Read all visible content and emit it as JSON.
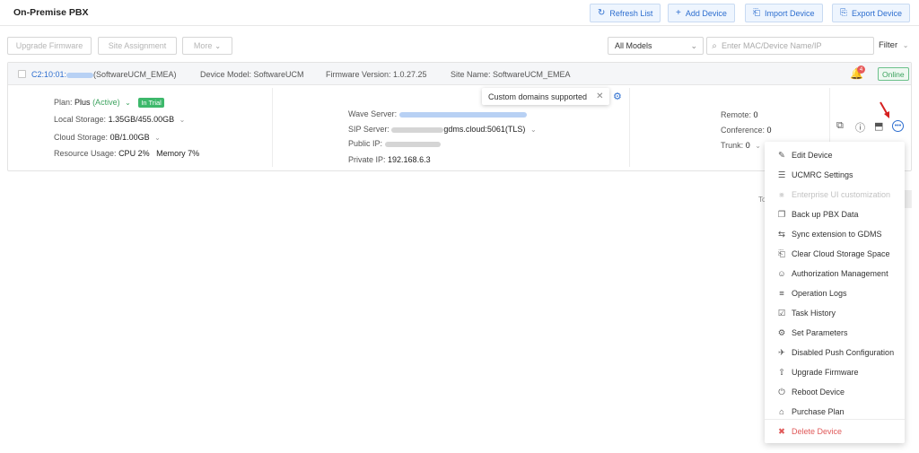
{
  "header": {
    "title": "On-Premise PBX",
    "buttons": {
      "refresh": "Refresh List",
      "add": "Add Device",
      "import": "Import Device",
      "export": "Export Device"
    }
  },
  "toolbar": {
    "upgrade": "Upgrade Firmware",
    "site": "Site Assignment",
    "more": "More",
    "model_select": "All Models",
    "search_placeholder": "Enter MAC/Device Name/IP",
    "filter": "Filter"
  },
  "device": {
    "mac_prefix": "C2:10:01:",
    "name": "(SoftwareUCM_EMEA)",
    "model": "Device Model: SoftwareUCM",
    "firmware": "Firmware Version: 1.0.27.25",
    "site": "Site Name: SoftwareUCM_EMEA",
    "notification_count": "4",
    "status": "Online",
    "plan_label": "Plan:",
    "plan_value": "Plus",
    "plan_state": "(Active)",
    "trial": "In Trial",
    "local_storage_label": "Local Storage:",
    "local_storage_value": "1.35GB/455.00GB",
    "cloud_storage_label": "Cloud Storage:",
    "cloud_storage_value": "0B/1.00GB",
    "resource_label": "Resource Usage:",
    "cpu": "CPU 2%",
    "memory": "Memory 7%",
    "wave_label": "Wave Server:",
    "sip_label": "SIP Server:",
    "sip_value": "gdms.cloud:5061(TLS)",
    "public_ip_label": "Public IP:",
    "private_ip_label": "Private IP:",
    "private_ip_value": "192.168.6.3",
    "tooltip": "Custom domains supported",
    "remote_label": "Remote:",
    "remote_value": "0",
    "conference_label": "Conference:",
    "conference_value": "0",
    "trunk_label": "Trunk:",
    "trunk_value": "0",
    "partial_text": "To"
  },
  "menu": [
    {
      "label": "Edit Device",
      "icon": "edit-icon"
    },
    {
      "label": "UCMRC Settings",
      "icon": "sliders-icon"
    },
    {
      "label": "Enterprise UI customization",
      "icon": "palette-icon",
      "disabled": true
    },
    {
      "label": "Back up PBX Data",
      "icon": "backup-icon"
    },
    {
      "label": "Sync extension to GDMS",
      "icon": "sync-icon"
    },
    {
      "label": "Clear Cloud Storage Space",
      "icon": "clear-storage-icon"
    },
    {
      "label": "Authorization Management",
      "icon": "user-key-icon"
    },
    {
      "label": "Operation Logs",
      "icon": "log-icon"
    },
    {
      "label": "Task History",
      "icon": "task-icon"
    },
    {
      "label": "Set Parameters",
      "icon": "gear-icon"
    },
    {
      "label": "Disabled Push Configuration",
      "icon": "push-off-icon"
    },
    {
      "label": "Upgrade Firmware",
      "icon": "upgrade-icon"
    },
    {
      "label": "Reboot Device",
      "icon": "power-icon"
    },
    {
      "label": "Purchase Plan",
      "icon": "cart-icon"
    },
    {
      "label": "Delete Device",
      "icon": "trash-icon",
      "danger": true
    }
  ],
  "colors": {
    "accent": "#2d6ecf",
    "online": "#3da35f",
    "danger": "#e05a5a",
    "arrow": "#d62020"
  }
}
